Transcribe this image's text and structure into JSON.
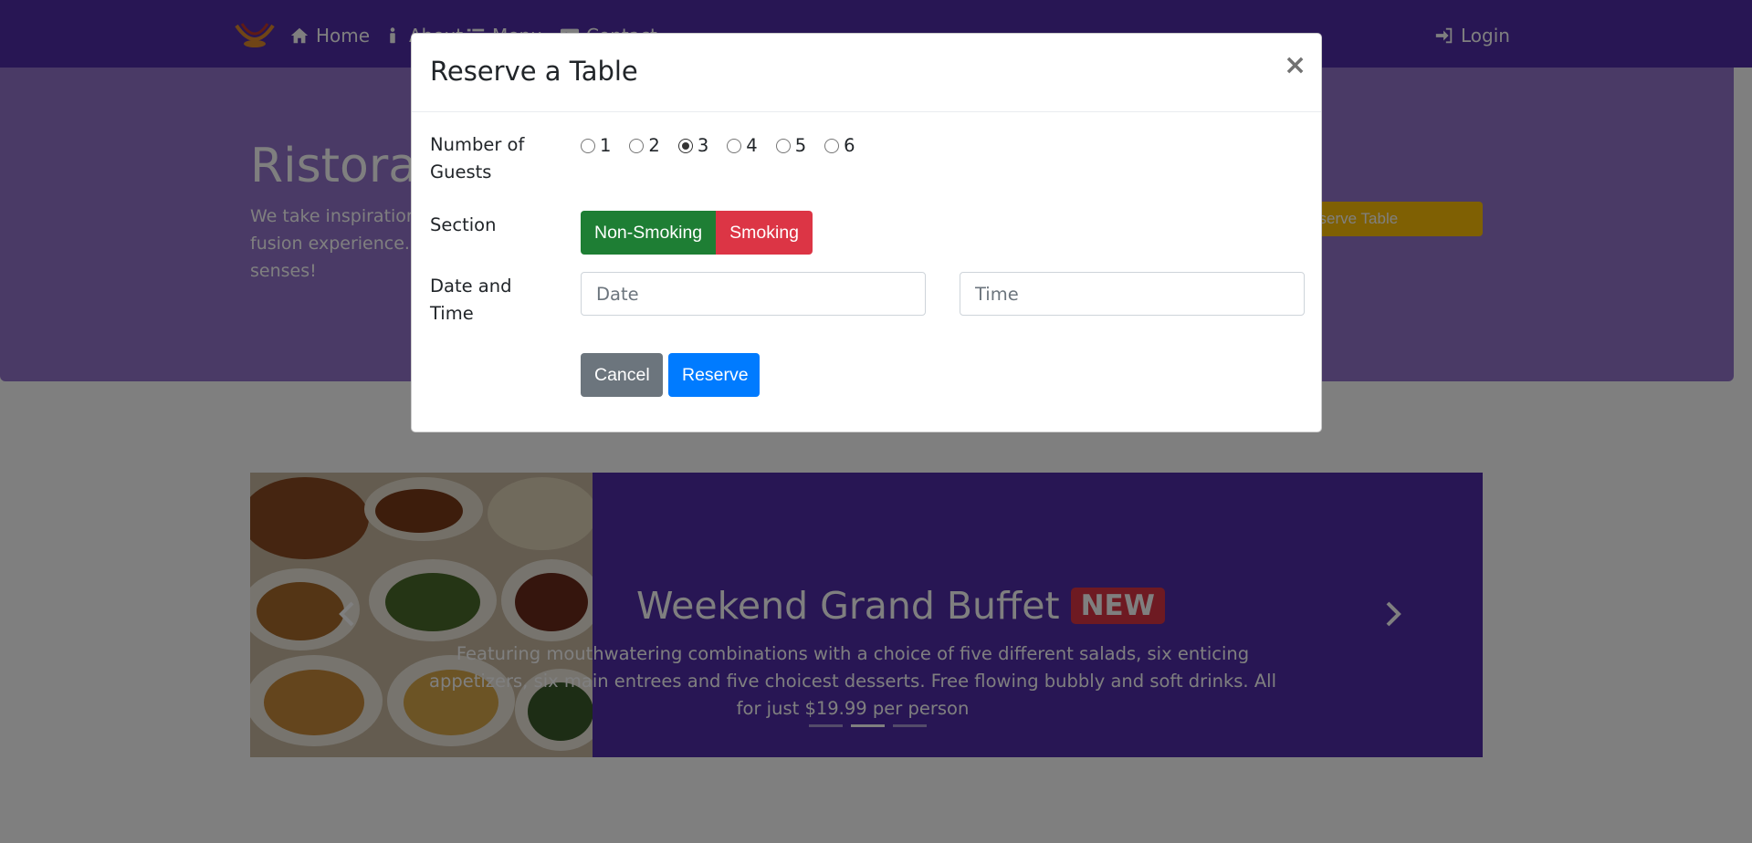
{
  "navbar": {
    "items": [
      {
        "label": "Home",
        "icon": "home-icon"
      },
      {
        "label": "About",
        "icon": "info-icon"
      },
      {
        "label": "Menu",
        "icon": "list-icon"
      },
      {
        "label": "Contact",
        "icon": "address-card-icon"
      }
    ],
    "login": {
      "label": "Login",
      "icon": "sign-in-icon"
    }
  },
  "jumbotron": {
    "title": "Ristorante con Fusion",
    "text": "We take inspiration from the World's best cuisines, and create a unique fusion experience. Our lipsmacking creations will tickle your culinary senses!",
    "reserve_button": "Reserve Table"
  },
  "carousel": {
    "title": "Weekend Grand Buffet",
    "badge": "NEW",
    "text": "Featuring mouthwatering combinations with a choice of five different salads, six enticing appetizers, six main entrees and five choicest desserts. Free flowing bubbly and soft drinks. All for just $19.99 per person",
    "indicators": [
      false,
      true,
      false
    ]
  },
  "modal": {
    "title": "Reserve a Table",
    "close": "×",
    "guests_label": "Number of Guests",
    "guests_options": [
      "1",
      "2",
      "3",
      "4",
      "5",
      "6"
    ],
    "guests_selected": "3",
    "section_label": "Section",
    "section_options": [
      "Non-Smoking",
      "Smoking"
    ],
    "datetime_label": "Date and Time",
    "date_placeholder": "Date",
    "time_placeholder": "Time",
    "cancel_label": "Cancel",
    "reserve_label": "Reserve"
  },
  "colors": {
    "primary": "#512da8",
    "light_primary": "#9575cd",
    "success": "#1e7e34",
    "danger": "#dc3545",
    "secondary": "#6c757d",
    "blue": "#007bff",
    "warning": "#ffc107"
  }
}
